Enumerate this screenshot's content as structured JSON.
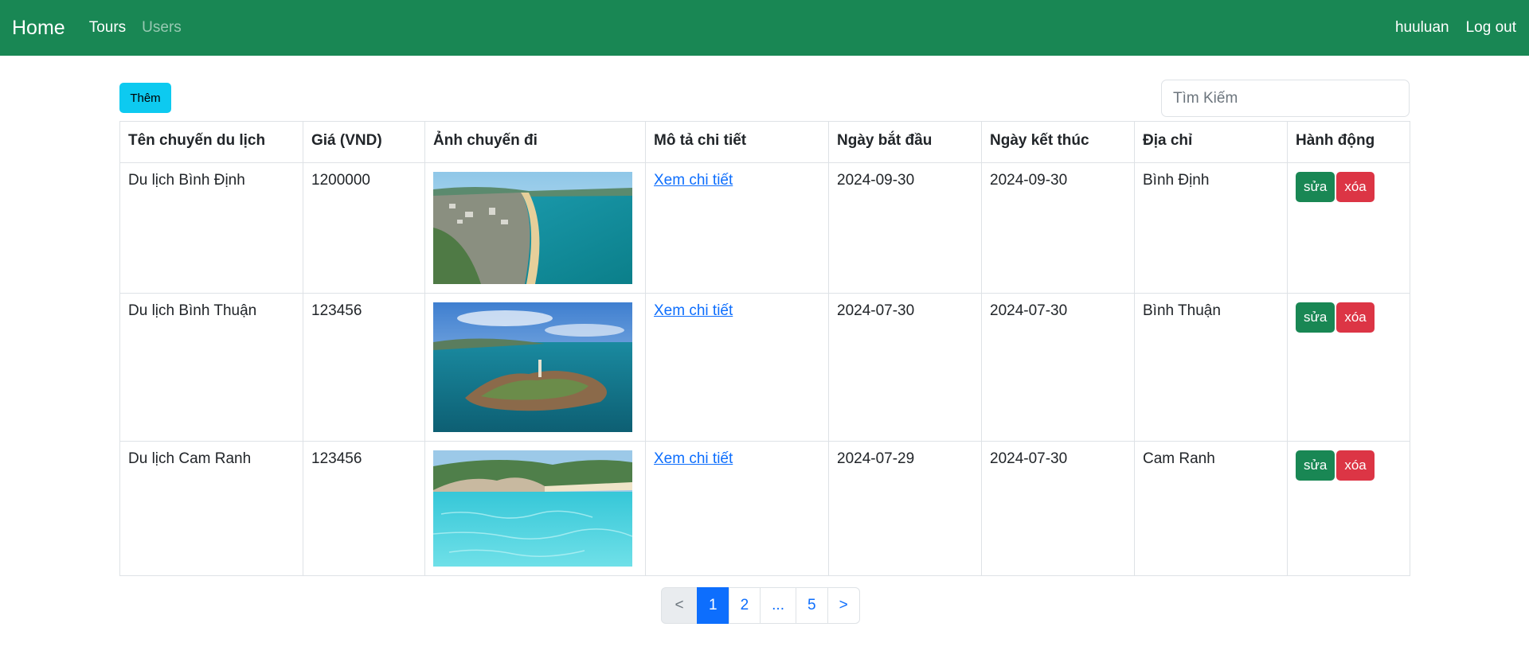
{
  "navbar": {
    "brand": "Home",
    "links": [
      "Tours",
      "Users"
    ],
    "username": "huuluan",
    "logout": "Log out"
  },
  "toolbar": {
    "add_label": "Thêm",
    "search_placeholder": "Tìm Kiếm"
  },
  "table": {
    "headers": [
      "Tên chuyến du lịch",
      "Giá (VND)",
      "Ảnh chuyến đi",
      "Mô tả chi tiết",
      "Ngày bắt đầu",
      "Ngày kết thúc",
      "Địa chỉ",
      "Hành động"
    ],
    "rows": [
      {
        "name": "Du lịch Bình Định",
        "price": "1200000",
        "detail": "Xem chi tiết",
        "start": "2024-09-30",
        "end": "2024-09-30",
        "address": "Bình Định",
        "edit": "sửa",
        "delete": "xóa"
      },
      {
        "name": "Du lịch Bình Thuận",
        "price": "123456",
        "detail": "Xem chi tiết",
        "start": "2024-07-30",
        "end": "2024-07-30",
        "address": "Bình Thuận",
        "edit": "sửa",
        "delete": "xóa"
      },
      {
        "name": "Du lịch Cam Ranh",
        "price": "123456",
        "detail": "Xem chi tiết",
        "start": "2024-07-29",
        "end": "2024-07-30",
        "address": "Cam Ranh",
        "edit": "sửa",
        "delete": "xóa"
      }
    ]
  },
  "pagination": [
    "<",
    "1",
    "2",
    "...",
    "5",
    ">"
  ],
  "colors": {
    "navbar": "#198754",
    "add_button": "#0dcaf0",
    "edit_button": "#198754",
    "delete_button": "#dc3545",
    "link": "#0d6efd"
  }
}
